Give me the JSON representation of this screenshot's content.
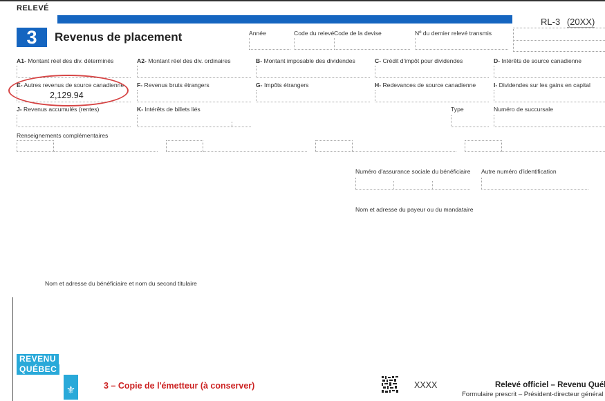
{
  "header": {
    "releve": "RELEVÉ",
    "slip_number": "3",
    "title": "Revenus de placement",
    "form_id": "RL-3",
    "year_code": "(20XX)",
    "annee_label": "Année",
    "code_releve_label": "Code du relevé",
    "code_devise_label": "Code de la devise",
    "dernier_releve_label": "Nº du dernier relevé transmis"
  },
  "boxes": {
    "a1": {
      "code": "A1-",
      "label": "Montant réel des div. déterminés"
    },
    "a2": {
      "code": "A2-",
      "label": "Montant réel des div. ordinaires"
    },
    "b": {
      "code": "B-",
      "label": "Montant imposable des dividendes"
    },
    "c": {
      "code": "C-",
      "label": "Crédit d'impôt pour dividendes"
    },
    "d": {
      "code": "D-",
      "label": "Intérêts de source canadienne"
    },
    "e": {
      "code": "E-",
      "label": "Autres revenus de source canadienne",
      "value": "2,129.94"
    },
    "f": {
      "code": "F-",
      "label": "Revenus bruts étrangers"
    },
    "g": {
      "code": "G-",
      "label": "Impôts étrangers"
    },
    "h": {
      "code": "H-",
      "label": "Redevances de source canadienne"
    },
    "i": {
      "code": "I-",
      "label": "Dividendes sur les gains en capital"
    },
    "j": {
      "code": "J-",
      "label": "Revenus accumulés (rentes)"
    },
    "k": {
      "code": "K-",
      "label": "Intérêts de billets liés"
    },
    "type": {
      "label": "Type"
    },
    "succursale": {
      "label": "Numéro de succursale"
    }
  },
  "section": {
    "renseignements": "Renseignements complémentaires",
    "nas_label": "Numéro d'assurance sociale du bénéficiaire",
    "autre_id_label": "Autre numéro d'identification",
    "payeur_label": "Nom et adresse du payeur ou du mandataire",
    "beneficiaire_label": "Nom et adresse du bénéficiaire et nom du second titulaire"
  },
  "footer": {
    "logo_line1": "REVENU",
    "logo_line2": "QUÉBEC",
    "copy_text": "3 – Copie de l'émetteur (à conserver)",
    "barcode_text": "XXXX",
    "official_text": "Relevé officiel – Revenu Québec",
    "prescribed_text": "Formulaire prescrit – Président-directeur général"
  },
  "colors": {
    "brand_blue": "#1565c0",
    "logo_cyan": "#29a9d9",
    "highlight_red": "#d64545",
    "copy_red": "#cc2222"
  }
}
